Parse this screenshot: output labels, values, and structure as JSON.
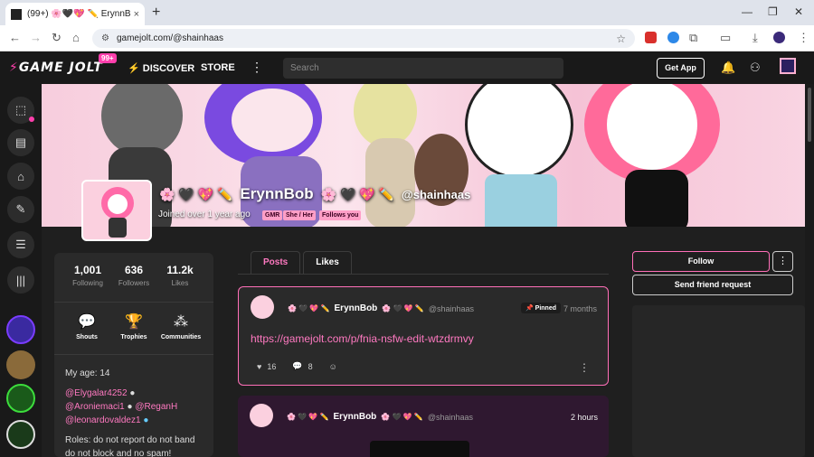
{
  "browser": {
    "tab_title": "(99+) 🌸🖤💖 ✏️ ErynnBob 🌸",
    "tab_close": "×",
    "new_tab": "+",
    "url": "gamejolt.com/@shainhaas"
  },
  "gj": {
    "logo": "GAME JOLT",
    "notif_count": "99+",
    "nav": {
      "discover": "DISCOVER",
      "store": "STORE"
    },
    "search_placeholder": "Search",
    "get_app": "Get App"
  },
  "profile": {
    "display_name": "ErynnBob",
    "emoji_before": "🌸 🖤 💖 ✏️",
    "emoji_after": "🌸 🖤 💖 ✏️",
    "username": "@shainhaas",
    "joined": "Joined over 1 year ago",
    "tags": [
      "GMR",
      "She / Her",
      "Follows you"
    ]
  },
  "stats": {
    "following": {
      "value": "1,001",
      "label": "Following"
    },
    "followers": {
      "value": "636",
      "label": "Followers"
    },
    "likes": {
      "value": "11.2k",
      "label": "Likes"
    }
  },
  "quick_links": {
    "shouts": "Shouts",
    "trophies": "Trophies",
    "communities": "Communities"
  },
  "bio": {
    "age": "My age: 14",
    "m1": "@Elygalar4252",
    "m2": "@Aroniemaci1",
    "m3": "@ReganH",
    "m4": "@leonardovaldez1",
    "roles_1": "Roles: do not report do not band",
    "roles_2": "do not block and no spam!"
  },
  "tabs": {
    "posts": "Posts",
    "likes": "Likes"
  },
  "posts": [
    {
      "name": "ErynnBob",
      "emoji": "🌸 🖤 💖 ✏️",
      "emoji_after": "🌸 🖤 💖 ✏️",
      "user": "@shainhaas",
      "pinned_label": "Pinned",
      "time": "7 months",
      "link": "https://gamejolt.com/p/fnia-nsfw-edit-wtzdrmvy",
      "likes": "16",
      "comments": "8"
    },
    {
      "name": "ErynnBob",
      "emoji": "🌸 🖤 💖 ✏️",
      "emoji_after": "🌸 🖤 💖 ✏️",
      "user": "@shainhaas",
      "time": "2 hours"
    }
  ],
  "actions": {
    "follow": "Follow",
    "friend_request": "Send friend request"
  },
  "colors": {
    "accent": "#ff3fac",
    "link": "#ff79c1",
    "background": "#1f1f1f"
  }
}
